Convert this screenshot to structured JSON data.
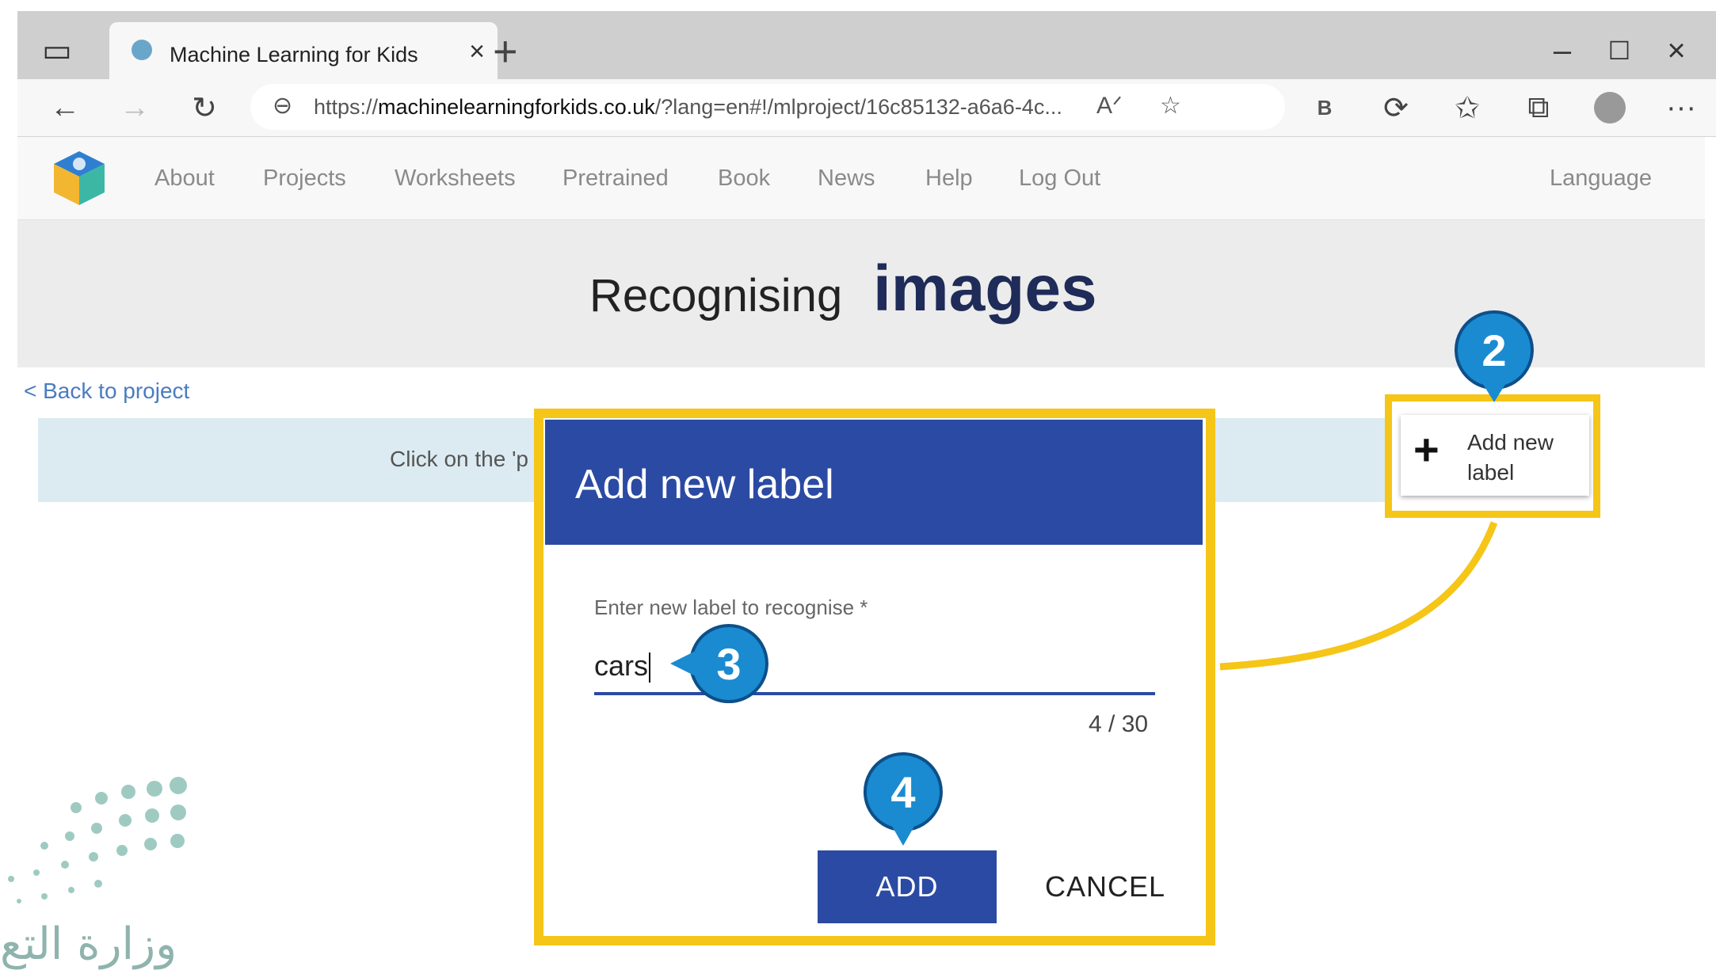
{
  "browser": {
    "tab_title": "Machine Learning for Kids",
    "url_prefix": "https://",
    "url_host": "machinelearningforkids.co.uk",
    "url_path": "/?lang=en#!/mlproject/16c85132-a6a6-4c...",
    "profile_badge": "B"
  },
  "site": {
    "menu": [
      "About",
      "Projects",
      "Worksheets",
      "Pretrained",
      "Book",
      "News",
      "Help",
      "Log Out"
    ],
    "language": "Language",
    "hero_sub": "Recognising",
    "hero_main": "images",
    "back_link": "< Back to project",
    "banner_text": "Click on the 'p",
    "add_label_button": "Add new label"
  },
  "dialog": {
    "title": "Add new label",
    "field_label": "Enter new label to recognise *",
    "field_value": "cars",
    "counter": "4 / 30",
    "add_button": "ADD",
    "cancel_button": "CANCEL"
  },
  "annotations": {
    "step_2": "2",
    "step_3": "3",
    "step_4": "4"
  },
  "watermark_text": "وزارة التع",
  "colors": {
    "dialog_header": "#2b4aa3",
    "highlight": "#f5c518",
    "marker": "#1a8bd0",
    "hero_title": "#1f2b58"
  }
}
